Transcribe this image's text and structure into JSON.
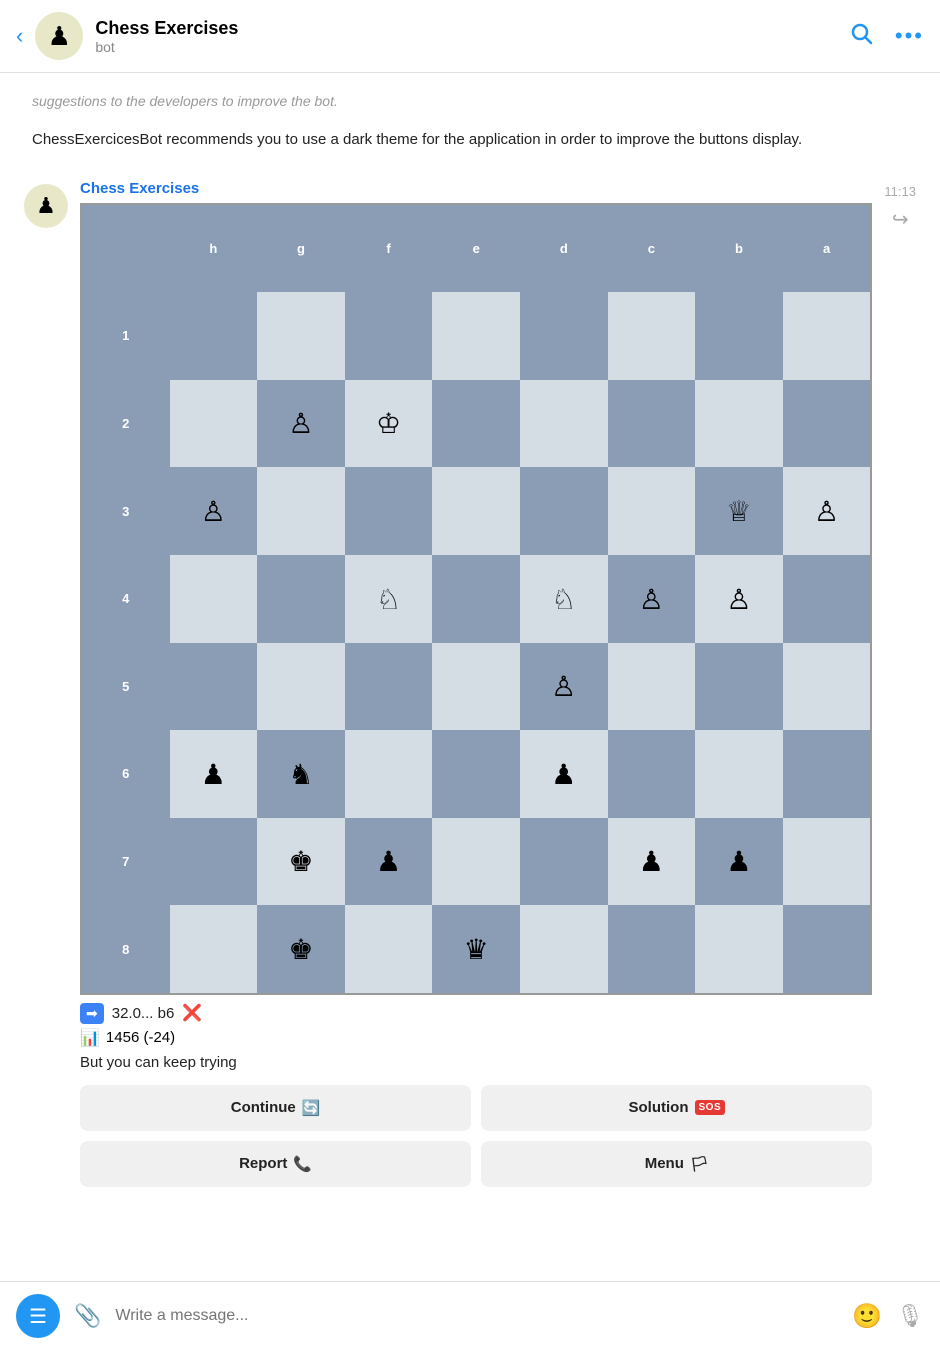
{
  "header": {
    "back_label": "‹",
    "bot_name": "Chess Exercises",
    "bot_sub": "bot",
    "search_icon": "search",
    "more_icon": "more"
  },
  "messages": {
    "system_text": "suggestions to the developers to improve the bot.",
    "recommendation_text": "ChessExercicesBot recommends you to use a dark theme for the application in order to improve the buttons display.",
    "bot_sender": "Chess Exercises",
    "time": "11:13",
    "move_prefix": "32.0...",
    "move_notation": "b6",
    "rating": "1456 (-24)",
    "trying_text": "But you can keep trying",
    "continue_label": "Continue 🔄",
    "solution_label": "Solution",
    "report_label": "Report 📞",
    "menu_label": "Menu 🏳"
  },
  "input": {
    "placeholder": "Write a message...",
    "menu_icon": "☰",
    "attach_icon": "📎",
    "emoji_icon": "😊",
    "mic_icon": "🎙"
  },
  "board": {
    "ranks": [
      "1",
      "2",
      "3",
      "4",
      "5",
      "6",
      "7",
      "8"
    ],
    "files": [
      "h",
      "g",
      "f",
      "e",
      "d",
      "c",
      "b",
      "a"
    ],
    "pieces": {
      "b2_white_pawn": {
        "rank": 2,
        "file": "g",
        "piece": "♙"
      },
      "c2_white_king": {
        "rank": 2,
        "file": "f",
        "piece": "♔"
      },
      "a3_white_pawn": {
        "rank": 3,
        "file": "h",
        "piece": "♙"
      },
      "g3_white_queen": {
        "rank": 3,
        "file": "b",
        "piece": "♕"
      },
      "h3_white_pawn": {
        "rank": 3,
        "file": "a",
        "piece": "♙"
      },
      "c4_white_knight": {
        "rank": 4,
        "file": "f",
        "piece": "♘"
      },
      "e4_white_knight": {
        "rank": 4,
        "file": "d",
        "piece": "♘"
      },
      "f4_white_pawn": {
        "rank": 4,
        "file": "c",
        "piece": "♙"
      },
      "g4_white_pawn": {
        "rank": 4,
        "file": "b",
        "piece": "♙"
      },
      "e5_white_pawn": {
        "rank": 5,
        "file": "d",
        "piece": "♙"
      },
      "a6_black_pawn": {
        "rank": 6,
        "file": "h",
        "piece": "♟"
      },
      "b6_black_knight": {
        "rank": 6,
        "file": "g",
        "piece": "♞"
      },
      "e6_black_pawn": {
        "rank": 6,
        "file": "d",
        "piece": "♟"
      },
      "b7_black_king": {
        "rank": 7,
        "file": "g",
        "piece": "♚"
      },
      "c7_black_pawn": {
        "rank": 7,
        "file": "f",
        "piece": "♟"
      },
      "f7_black_pawn": {
        "rank": 7,
        "file": "c",
        "piece": "♟"
      },
      "g7_black_pawn": {
        "rank": 7,
        "file": "b",
        "piece": "♟"
      },
      "b8_black_king2": {
        "rank": 8,
        "file": "g",
        "piece": "♚"
      },
      "e8_black_queen": {
        "rank": 8,
        "file": "e",
        "piece": "♛"
      }
    }
  }
}
